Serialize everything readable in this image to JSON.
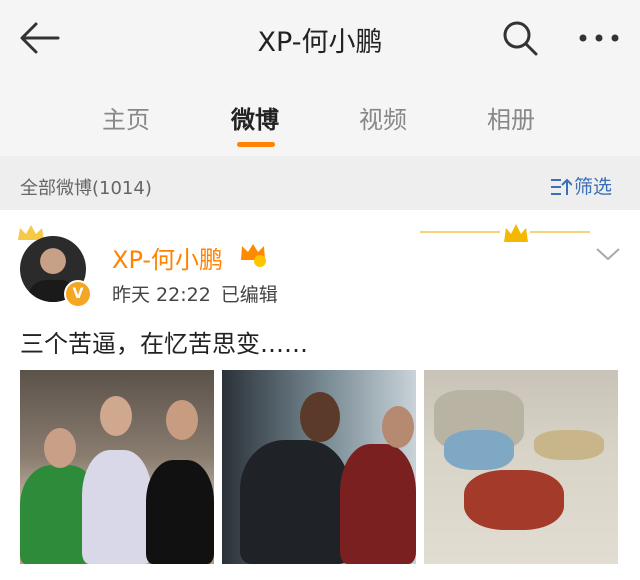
{
  "header": {
    "title": "XP-何小鹏",
    "back_icon": "arrow-left-icon",
    "search_icon": "search-icon",
    "more_icon": "more-dots-icon"
  },
  "tabs": [
    {
      "label": "主页",
      "active": false
    },
    {
      "label": "微博",
      "active": true
    },
    {
      "label": "视频",
      "active": false
    },
    {
      "label": "相册",
      "active": false
    }
  ],
  "filter_bar": {
    "label": "全部微博(1014)",
    "filter_label": "筛选"
  },
  "post": {
    "username": "XP-何小鹏",
    "verified_badge": "V",
    "time": "昨天 22:22",
    "edited": "已编辑",
    "text": "三个苦逼，在忆苦思变……",
    "photos": [
      "group-photo",
      "avengers-photo",
      "ink-painting-photo"
    ]
  },
  "colors": {
    "accent": "#ff8200",
    "link": "#3c6fb5",
    "header_bg": "#f5f5f5",
    "filter_bg": "#eeeeee"
  }
}
